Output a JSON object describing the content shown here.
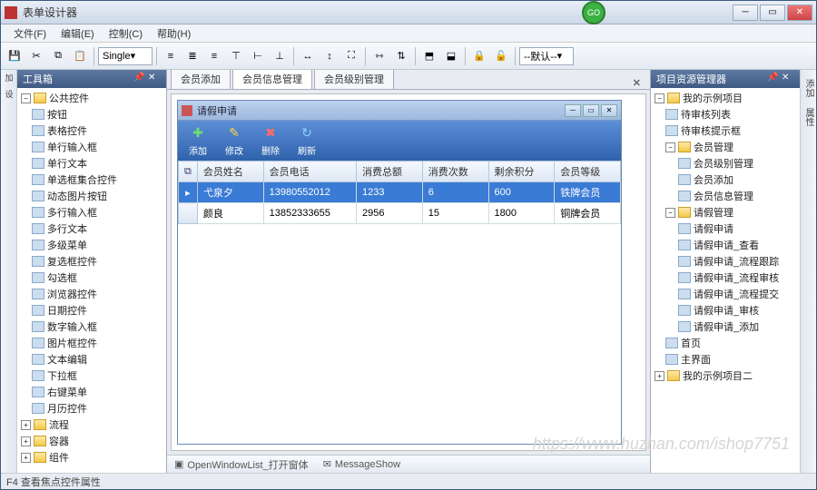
{
  "window": {
    "title": "表单设计器",
    "go_badge": "GO"
  },
  "menu": [
    "文件(F)",
    "编辑(E)",
    "控制(C)",
    "帮助(H)"
  ],
  "toolbar": {
    "single": "Single",
    "default": "--默认--"
  },
  "leftpanel": {
    "title": "工具箱"
  },
  "toolbox": {
    "root": "公共控件",
    "items": [
      "按钮",
      "表格控件",
      "单行输入框",
      "单行文本",
      "单选框集合控件",
      "动态图片按钮",
      "多行输入框",
      "多行文本",
      "多级菜单",
      "复选框控件",
      "勾选框",
      "浏览器控件",
      "日期控件",
      "数字输入框",
      "图片框控件",
      "文本编辑",
      "下拉框",
      "右键菜单",
      "月历控件"
    ],
    "groups": [
      "流程",
      "容器",
      "组件"
    ]
  },
  "tabs": [
    "会员添加",
    "会员信息管理",
    "会员级别管理"
  ],
  "innerwin": {
    "title": "请假申请",
    "buttons": [
      {
        "label": "添加",
        "icon": "✚",
        "color": "#6fe06f"
      },
      {
        "label": "修改",
        "icon": "✎",
        "color": "#ffd24d"
      },
      {
        "label": "删除",
        "icon": "✖",
        "color": "#ff6a6a"
      },
      {
        "label": "刷新",
        "icon": "↻",
        "color": "#8fd0ff"
      }
    ],
    "columns": [
      "会员姓名",
      "会员电话",
      "消费总额",
      "消费次数",
      "剩余积分",
      "会员等级"
    ],
    "rows": [
      {
        "sel": true,
        "cells": [
          "弋泉夕",
          "13980552012",
          "1233",
          "6",
          "600",
          "铁牌会员"
        ]
      },
      {
        "sel": false,
        "cells": [
          "颜良",
          "13852333655",
          "2956",
          "15",
          "1800",
          "铜牌会员"
        ]
      }
    ]
  },
  "rightpanel": {
    "title": "项目资源管理器"
  },
  "project": {
    "root": "我的示例项目",
    "n1": [
      "待审核列表",
      "待审核提示框"
    ],
    "g1": {
      "label": "会员管理",
      "items": [
        "会员级别管理",
        "会员添加",
        "会员信息管理"
      ]
    },
    "g2": {
      "label": "请假管理",
      "items": [
        "请假申请",
        "请假申请_查看",
        "请假申请_流程跟踪",
        "请假申请_流程审核",
        "请假申请_流程提交",
        "请假申请_审核",
        "请假申请_添加"
      ]
    },
    "n2": [
      "首页",
      "主界面"
    ],
    "root2": "我的示例项目二"
  },
  "status": {
    "s1": "OpenWindowList_打开窗体",
    "s2": "MessageShow"
  },
  "footer": "F4 查看焦点控件属性",
  "sidetabs_left": [
    "加碎",
    "设计器"
  ],
  "sidetabs_right": [
    "添加",
    "属性"
  ],
  "watermark": "https://www.huzhan.com/ishop7751"
}
